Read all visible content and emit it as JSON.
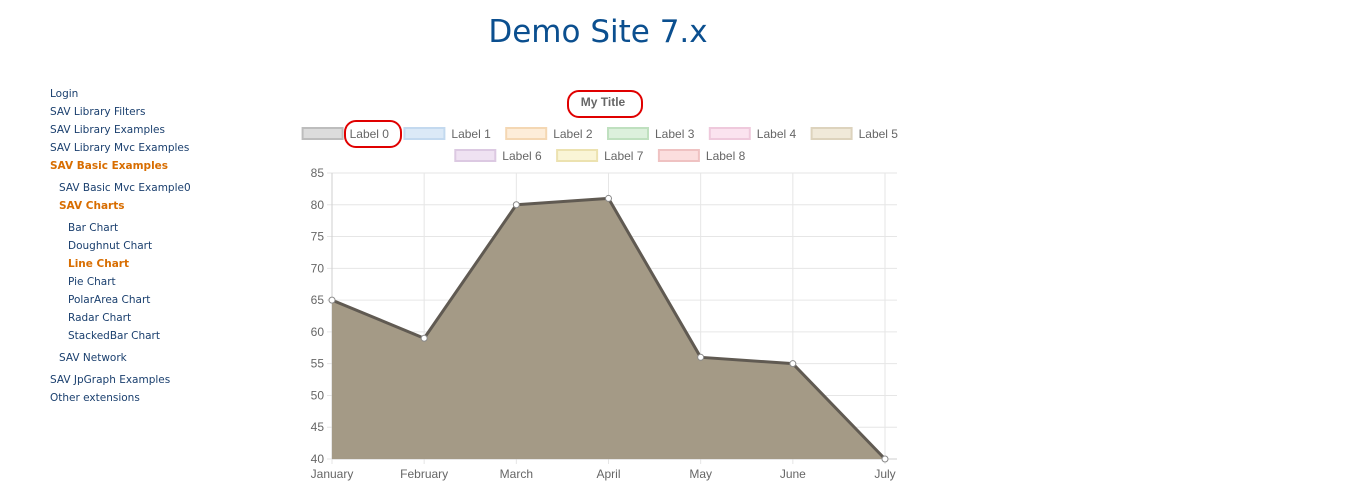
{
  "site": {
    "title": "Demo Site 7.x"
  },
  "nav": {
    "items": [
      {
        "label": "Login",
        "level": 0,
        "state": "normal"
      },
      {
        "label": "SAV Library Filters",
        "level": 0,
        "state": "normal"
      },
      {
        "label": "SAV Library Examples",
        "level": 0,
        "state": "normal"
      },
      {
        "label": "SAV Library Mvc Examples",
        "level": 0,
        "state": "normal"
      },
      {
        "label": "SAV Basic Examples",
        "level": 0,
        "state": "active"
      },
      {
        "label": "SAV Basic Mvc Example0",
        "level": 1,
        "state": "normal"
      },
      {
        "label": "SAV Charts",
        "level": 1,
        "state": "active"
      },
      {
        "label": "Bar Chart",
        "level": 2,
        "state": "normal"
      },
      {
        "label": "Doughnut Chart",
        "level": 2,
        "state": "normal"
      },
      {
        "label": "Line Chart",
        "level": 2,
        "state": "current"
      },
      {
        "label": "Pie Chart",
        "level": 2,
        "state": "normal"
      },
      {
        "label": "PolarArea Chart",
        "level": 2,
        "state": "normal"
      },
      {
        "label": "Radar Chart",
        "level": 2,
        "state": "normal"
      },
      {
        "label": "StackedBar Chart",
        "level": 2,
        "state": "normal"
      },
      {
        "label": "SAV Network",
        "level": 1,
        "state": "normal"
      },
      {
        "label": "SAV JpGraph Examples",
        "level": 0,
        "state": "normal"
      },
      {
        "label": "Other extensions",
        "level": 0,
        "state": "normal"
      }
    ]
  },
  "chart_data": {
    "type": "line",
    "title": "My Title",
    "categories": [
      "January",
      "February",
      "March",
      "April",
      "May",
      "June",
      "July"
    ],
    "series": [
      {
        "name": "Label 0",
        "values": [
          65,
          59,
          80,
          81,
          56,
          55,
          40
        ]
      }
    ],
    "legend": [
      {
        "name": "Label 0",
        "color": "#dcdcdc",
        "border": "#bdbdbd"
      },
      {
        "name": "Label 1",
        "color": "#dbe9f7",
        "border": "#c3d9ef"
      },
      {
        "name": "Label 2",
        "color": "#fdedd9",
        "border": "#f4d7b3"
      },
      {
        "name": "Label 3",
        "color": "#dcf0dc",
        "border": "#bfe0bf"
      },
      {
        "name": "Label 4",
        "color": "#fbe3ef",
        "border": "#efc9dc"
      },
      {
        "name": "Label 5",
        "color": "#f0e9d9",
        "border": "#ddd3bd"
      },
      {
        "name": "Label 6",
        "color": "#efe2f2",
        "border": "#dcc9e2"
      },
      {
        "name": "Label 7",
        "color": "#faf5d6",
        "border": "#ece2b0"
      },
      {
        "name": "Label 8",
        "color": "#fbdede",
        "border": "#efc2c2"
      }
    ],
    "ylim": [
      40,
      85
    ],
    "yticks": [
      40,
      45,
      50,
      55,
      60,
      65,
      70,
      75,
      80,
      85
    ],
    "grid": true,
    "legend_position": "top",
    "colors": {
      "fill": "#a49a86",
      "line": "#605a52",
      "grid": "#e6e6e6",
      "axis_text": "#666666"
    },
    "annotations": [
      {
        "target": "title"
      },
      {
        "target": "legend-0"
      }
    ]
  }
}
